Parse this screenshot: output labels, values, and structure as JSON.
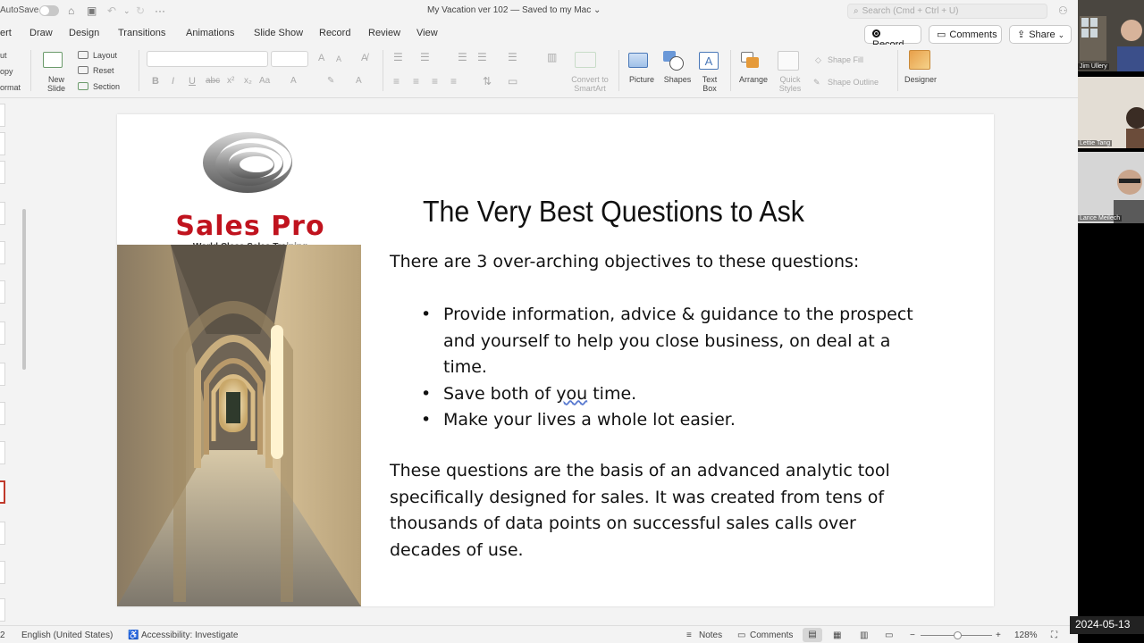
{
  "titlebar": {
    "autosave_label": "AutoSave",
    "document_title": "My Vacation ver 102 — Saved to my Mac ⌄",
    "search_placeholder": "Search (Cmd + Ctrl + U)"
  },
  "tabs": [
    "ert",
    "Draw",
    "Design",
    "Transitions",
    "Animations",
    "Slide Show",
    "Record",
    "Review",
    "View"
  ],
  "actions": {
    "record": "Record",
    "comments": "Comments",
    "share": "Share"
  },
  "ribbon": {
    "clipboard": [
      "ut",
      "opy",
      "ormat"
    ],
    "new_slide": [
      "New",
      "Slide"
    ],
    "layout": "Layout",
    "reset": "Reset",
    "section": "Section",
    "convert_smartart": [
      "Convert to",
      "SmartArt"
    ],
    "picture": "Picture",
    "shapes": "Shapes",
    "text_box": [
      "Text",
      "Box"
    ],
    "arrange": "Arrange",
    "quick_styles": [
      "Quick",
      "Styles"
    ],
    "shape_fill": "Shape Fill",
    "shape_outline": "Shape Outline",
    "designer": "Designer"
  },
  "slide": {
    "logo_name": "Sales Pro",
    "logo_tagline": "World Class Sales Training",
    "title": "The Very Best Questions to Ask",
    "intro": "There are 3 over-arching objectives to these questions:",
    "bullets": [
      "Provide information, advice & guidance to the prospect and yourself to help you close business, on deal at a time.",
      "Save both of you time.",
      "Make your lives a whole lot easier."
    ],
    "bullet2_pre": "Save both of ",
    "bullet2_mark": "you",
    "bullet2_post": " time.",
    "closing": [
      "These questions are the basis of an advanced analytic tool",
      "specifically designed for sales. It was created from tens of",
      "thousands of data points on successful sales calls over",
      "decades of use."
    ]
  },
  "statusbar": {
    "slide_num": "2",
    "language": "English (United States)",
    "accessibility": "Accessibility: Investigate",
    "notes": "Notes",
    "comments": "Comments",
    "zoom": "128%"
  },
  "video": {
    "participants": [
      "Jim Ullery",
      "Lettie Tang",
      "Lance Meilech"
    ],
    "date": "2024-05-13"
  }
}
